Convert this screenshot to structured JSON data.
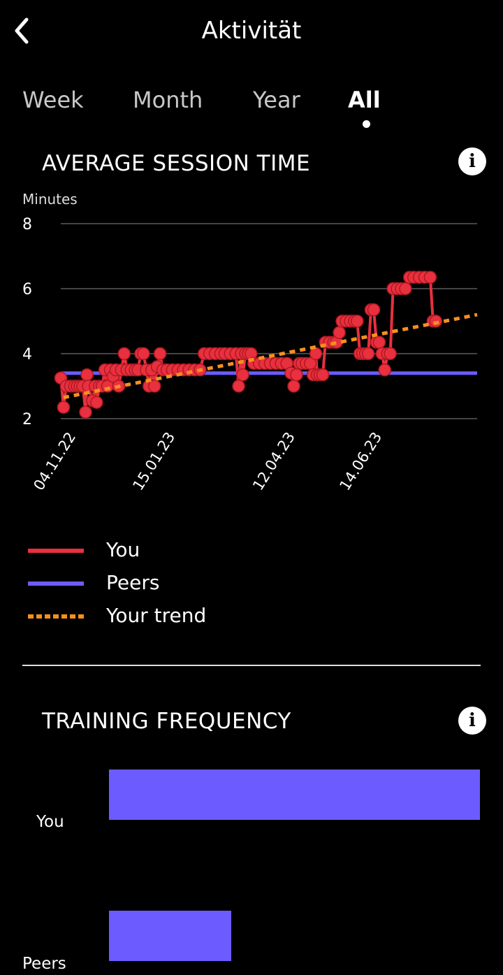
{
  "header": {
    "title": "Aktivität",
    "back_icon": "chevron-left-icon"
  },
  "tabs": [
    {
      "label": "Week",
      "active": false
    },
    {
      "label": "Month",
      "active": false
    },
    {
      "label": "Year",
      "active": false
    },
    {
      "label": "All",
      "active": true
    }
  ],
  "session_section": {
    "title": "AVERAGE SESSION TIME",
    "info_icon": "info-icon",
    "info_glyph": "i"
  },
  "freq_section": {
    "title": "TRAINING FREQUENCY",
    "info_icon": "info-icon",
    "info_glyph": "i"
  },
  "legend": [
    {
      "label": "You",
      "color": "#e8303e",
      "style": "solid"
    },
    {
      "label": "Peers",
      "color": "#6c5cff",
      "style": "solid"
    },
    {
      "label": "Your trend",
      "color": "#f5901f",
      "style": "dotted"
    }
  ],
  "chart_data": [
    {
      "type": "line",
      "title": "AVERAGE SESSION TIME",
      "ylabel": "Minutes",
      "ylim": [
        2,
        8
      ],
      "yticks": [
        2,
        4,
        6,
        8
      ],
      "xlim": [
        "2022-11-04",
        "2023-09-02"
      ],
      "xticks": [
        {
          "date": "2022-11-04",
          "label": "04.11.22"
        },
        {
          "date": "2023-01-15",
          "label": "15.01.23"
        },
        {
          "date": "2023-04-12",
          "label": "12.04.23"
        },
        {
          "date": "2023-06-14",
          "label": "14.06.23"
        }
      ],
      "grid": true,
      "legend_position": "bottom",
      "series": [
        {
          "name": "You",
          "color": "#e8303e",
          "points": [
            [
              "2022-11-04",
              3.25
            ],
            [
              "2022-11-06",
              2.35
            ],
            [
              "2022-11-08",
              3.0
            ],
            [
              "2022-11-11",
              3.0
            ],
            [
              "2022-11-14",
              3.0
            ],
            [
              "2022-11-16",
              3.0
            ],
            [
              "2022-11-18",
              3.0
            ],
            [
              "2022-11-20",
              3.0
            ],
            [
              "2022-11-22",
              2.2
            ],
            [
              "2022-11-23",
              3.35
            ],
            [
              "2022-11-24",
              3.0
            ],
            [
              "2022-11-27",
              2.55
            ],
            [
              "2022-11-29",
              3.0
            ],
            [
              "2022-11-30",
              2.5
            ],
            [
              "2022-12-02",
              3.0
            ],
            [
              "2022-12-04",
              3.0
            ],
            [
              "2022-12-06",
              3.5
            ],
            [
              "2022-12-08",
              3.0
            ],
            [
              "2022-12-10",
              3.5
            ],
            [
              "2022-12-12",
              3.3
            ],
            [
              "2022-12-14",
              3.5
            ],
            [
              "2022-12-16",
              3.0
            ],
            [
              "2022-12-18",
              3.5
            ],
            [
              "2022-12-20",
              4.0
            ],
            [
              "2022-12-22",
              3.5
            ],
            [
              "2022-12-25",
              3.5
            ],
            [
              "2022-12-28",
              3.5
            ],
            [
              "2022-12-30",
              3.5
            ],
            [
              "2023-01-01",
              4.0
            ],
            [
              "2023-01-03",
              4.0
            ],
            [
              "2023-01-05",
              3.5
            ],
            [
              "2023-01-07",
              3.0
            ],
            [
              "2023-01-09",
              3.5
            ],
            [
              "2023-01-11",
              3.0
            ],
            [
              "2023-01-13",
              3.6
            ],
            [
              "2023-01-15",
              4.0
            ],
            [
              "2023-01-17",
              3.5
            ],
            [
              "2023-01-20",
              3.5
            ],
            [
              "2023-01-24",
              3.5
            ],
            [
              "2023-01-28",
              3.5
            ],
            [
              "2023-02-01",
              3.5
            ],
            [
              "2023-02-05",
              3.5
            ],
            [
              "2023-02-09",
              3.5
            ],
            [
              "2023-02-13",
              3.5
            ],
            [
              "2023-02-16",
              4.0
            ],
            [
              "2023-02-20",
              4.0
            ],
            [
              "2023-02-24",
              4.0
            ],
            [
              "2023-02-28",
              4.0
            ],
            [
              "2023-03-03",
              4.0
            ],
            [
              "2023-03-07",
              4.0
            ],
            [
              "2023-03-11",
              4.0
            ],
            [
              "2023-03-13",
              3.0
            ],
            [
              "2023-03-15",
              4.0
            ],
            [
              "2023-03-16",
              3.35
            ],
            [
              "2023-03-18",
              4.0
            ],
            [
              "2023-03-20",
              4.0
            ],
            [
              "2023-03-22",
              4.0
            ],
            [
              "2023-03-24",
              3.7
            ],
            [
              "2023-03-28",
              3.7
            ],
            [
              "2023-04-01",
              3.7
            ],
            [
              "2023-04-05",
              3.7
            ],
            [
              "2023-04-09",
              3.7
            ],
            [
              "2023-04-13",
              3.7
            ],
            [
              "2023-04-17",
              3.7
            ],
            [
              "2023-04-20",
              3.4
            ],
            [
              "2023-04-22",
              3.0
            ],
            [
              "2023-04-24",
              3.35
            ],
            [
              "2023-04-26",
              3.7
            ],
            [
              "2023-04-28",
              3.7
            ],
            [
              "2023-05-01",
              3.7
            ],
            [
              "2023-05-04",
              3.7
            ],
            [
              "2023-05-06",
              3.35
            ],
            [
              "2023-05-08",
              4.0
            ],
            [
              "2023-05-09",
              3.35
            ],
            [
              "2023-05-11",
              3.35
            ],
            [
              "2023-05-13",
              3.35
            ],
            [
              "2023-05-15",
              4.35
            ],
            [
              "2023-05-18",
              4.35
            ],
            [
              "2023-05-21",
              4.35
            ],
            [
              "2023-05-23",
              4.35
            ],
            [
              "2023-05-25",
              4.65
            ],
            [
              "2023-05-27",
              5.0
            ],
            [
              "2023-05-30",
              5.0
            ],
            [
              "2023-06-02",
              5.0
            ],
            [
              "2023-06-05",
              5.0
            ],
            [
              "2023-06-07",
              5.0
            ],
            [
              "2023-06-09",
              4.0
            ],
            [
              "2023-06-11",
              4.0
            ],
            [
              "2023-06-13",
              4.0
            ],
            [
              "2023-06-15",
              4.0
            ],
            [
              "2023-06-17",
              5.35
            ],
            [
              "2023-06-19",
              5.35
            ],
            [
              "2023-06-21",
              4.35
            ],
            [
              "2023-06-23",
              4.35
            ],
            [
              "2023-06-25",
              4.0
            ],
            [
              "2023-06-27",
              3.5
            ],
            [
              "2023-06-29",
              4.0
            ],
            [
              "2023-07-01",
              4.0
            ],
            [
              "2023-07-03",
              6.0
            ],
            [
              "2023-07-06",
              6.0
            ],
            [
              "2023-07-09",
              6.0
            ],
            [
              "2023-07-12",
              6.0
            ],
            [
              "2023-07-15",
              6.35
            ],
            [
              "2023-07-18",
              6.35
            ],
            [
              "2023-07-22",
              6.35
            ],
            [
              "2023-07-26",
              6.35
            ],
            [
              "2023-07-30",
              6.35
            ],
            [
              "2023-08-01",
              5.0
            ],
            [
              "2023-08-03",
              5.0
            ]
          ]
        },
        {
          "name": "Peers",
          "color": "#6c5cff",
          "points": [
            [
              "2022-11-04",
              3.4
            ],
            [
              "2023-09-02",
              3.4
            ]
          ]
        },
        {
          "name": "Your trend",
          "color": "#f5901f",
          "points": [
            [
              "2022-11-06",
              2.65
            ],
            [
              "2023-09-02",
              5.2
            ]
          ]
        }
      ]
    },
    {
      "type": "bar",
      "title": "TRAINING FREQUENCY",
      "categories": [
        "You",
        "Peers"
      ],
      "values": [
        1.0,
        0.33
      ],
      "color": "#6c5cff",
      "orientation": "horizontal"
    }
  ]
}
